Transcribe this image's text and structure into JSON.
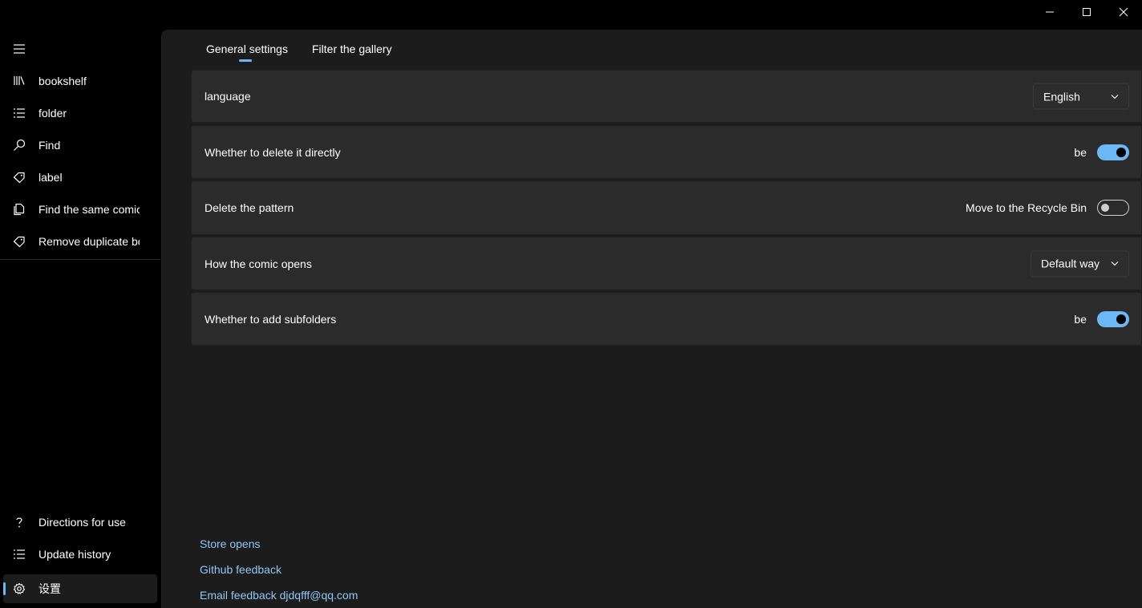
{
  "window": {
    "controls": [
      "minimize-icon",
      "maximize-icon",
      "close-icon"
    ]
  },
  "sidebar": {
    "toggle_icon": "hamburger-icon",
    "items": [
      {
        "label": "bookshelf",
        "icon": "library-icon"
      },
      {
        "label": "folder",
        "icon": "list-icon"
      },
      {
        "label": "Find",
        "icon": "search-icon"
      },
      {
        "label": "label",
        "icon": "tag-icon"
      },
      {
        "label": "Find the same comic",
        "icon": "copy-icon"
      },
      {
        "label": "Remove duplicate bo",
        "icon": "tag-icon"
      }
    ],
    "footer_items": [
      {
        "label": "Directions for use",
        "icon": "question-icon"
      },
      {
        "label": "Update history",
        "icon": "list-icon"
      },
      {
        "label": "设置",
        "icon": "gear-icon",
        "selected": true
      }
    ]
  },
  "tabs": [
    {
      "label": "General settings",
      "selected": true
    },
    {
      "label": "Filter the gallery",
      "selected": false
    }
  ],
  "settings": {
    "language": {
      "label": "language",
      "value": "English"
    },
    "delete_directly": {
      "label": "Whether to delete it directly",
      "state_text": "be",
      "on": true
    },
    "delete_pattern": {
      "label": "Delete the pattern",
      "state_text": "Move to the Recycle Bin",
      "on": false
    },
    "open_mode": {
      "label": "How the comic opens",
      "value": "Default way"
    },
    "add_subfolders": {
      "label": "Whether to add subfolders",
      "state_text": "be",
      "on": true
    }
  },
  "links": {
    "store": "Store opens",
    "github": "Github feedback",
    "email": "Email feedback djdqfff@qq.com"
  },
  "colors": {
    "accent": "#6cb8f6",
    "link": "#8fc6f5",
    "card": "#2b2b2b",
    "pane": "#1c1c1c"
  }
}
